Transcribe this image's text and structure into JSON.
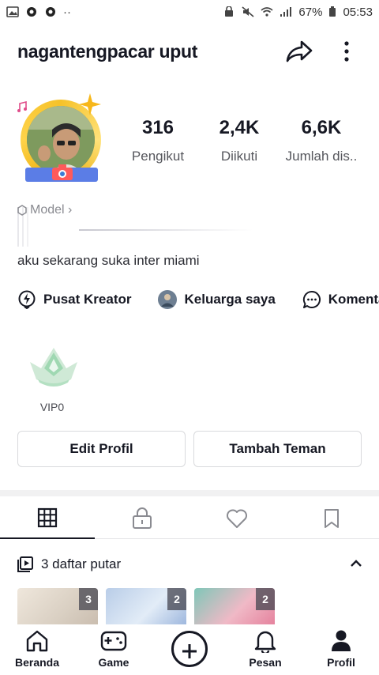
{
  "status_bar": {
    "battery": "67%",
    "time": "05:53"
  },
  "header": {
    "username": "nagantengpacar uput"
  },
  "stats": [
    {
      "value": "316",
      "label": "Pengikut"
    },
    {
      "value": "2,4K",
      "label": "Diikuti"
    },
    {
      "value": "6,6K",
      "label": "Jumlah dis.."
    }
  ],
  "profile": {
    "model_link": "Model ›",
    "bio": "aku sekarang suka inter miami"
  },
  "quick_links": [
    {
      "label": "Pusat Kreator",
      "icon": "lightning-bubble-icon"
    },
    {
      "label": "Keluarga saya",
      "icon": "family-avatar-icon"
    },
    {
      "label": "Komentar",
      "icon": "comment-bubble-icon"
    }
  ],
  "vip": {
    "label": "VIP0"
  },
  "buttons": {
    "edit": "Edit Profil",
    "add": "Tambah Teman"
  },
  "tabs": [
    {
      "name": "grid",
      "icon": "grid-icon",
      "active": true
    },
    {
      "name": "private",
      "icon": "lock-icon",
      "active": false
    },
    {
      "name": "liked",
      "icon": "heart-icon",
      "active": false
    },
    {
      "name": "saved",
      "icon": "bookmark-icon",
      "active": false
    }
  ],
  "playlist": {
    "title": "3 daftar putar",
    "thumbnails": [
      {
        "count": "3"
      },
      {
        "count": "2"
      },
      {
        "count": "2"
      }
    ]
  },
  "bottom_nav": [
    {
      "label": "Beranda",
      "icon": "home-icon"
    },
    {
      "label": "Game",
      "icon": "gamepad-icon"
    },
    {
      "label": "",
      "icon": "plus-icon"
    },
    {
      "label": "Pesan",
      "icon": "bell-icon"
    },
    {
      "label": "Profil",
      "icon": "person-icon"
    }
  ],
  "colors": {
    "text": "#161823",
    "muted": "#55565c",
    "border": "#d9dadd",
    "avatar_ring": "#f6c22a",
    "vip_green": "#8fd3a4"
  }
}
